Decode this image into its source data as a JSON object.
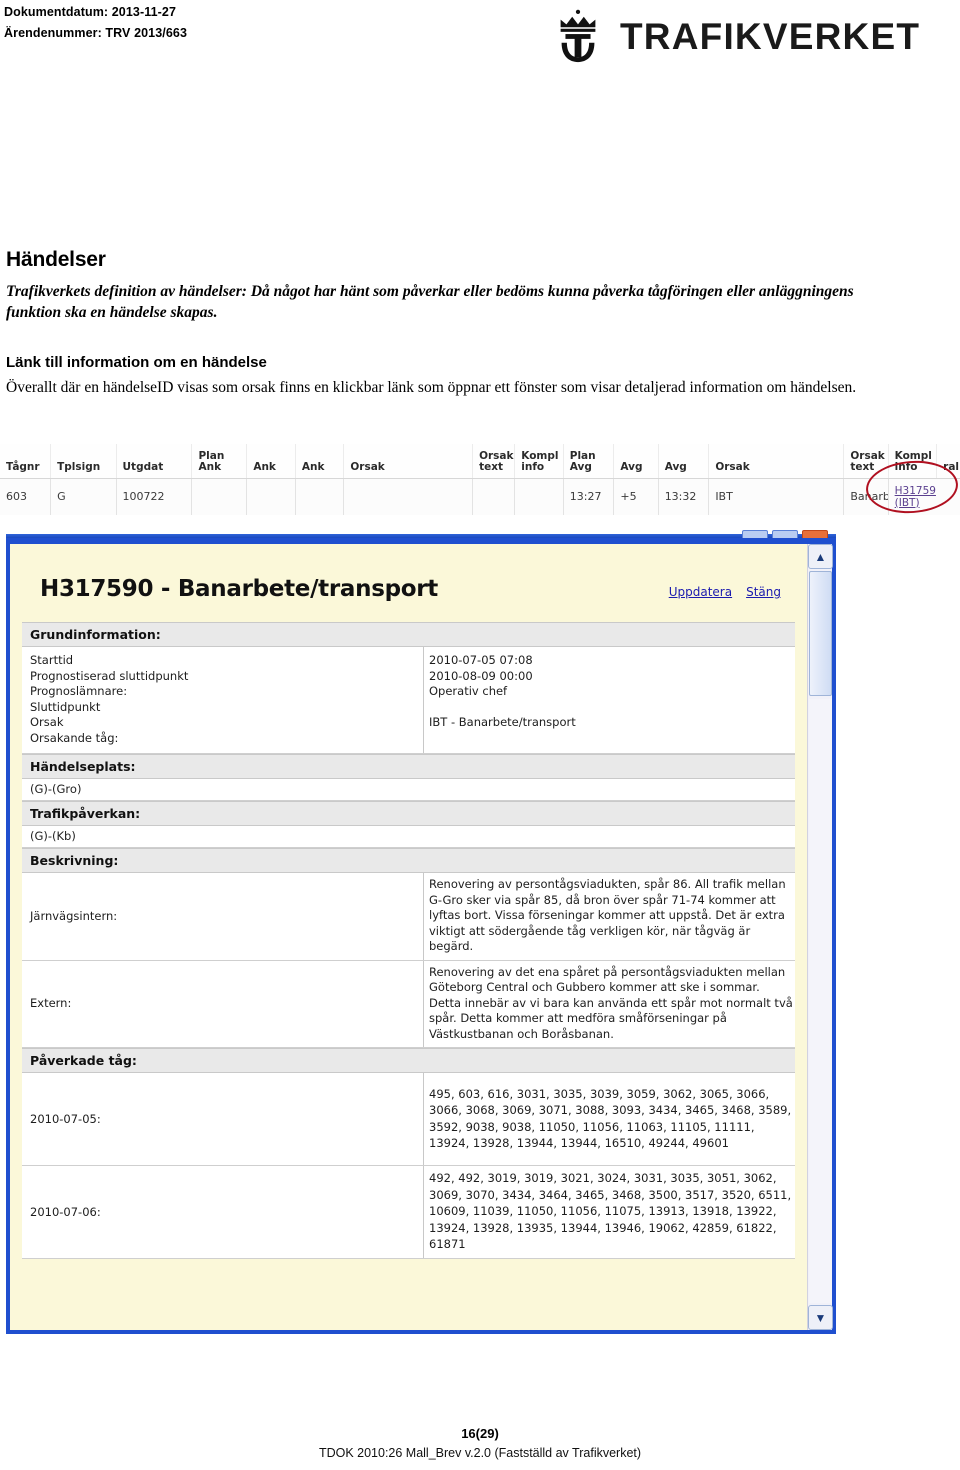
{
  "header": {
    "doc_date": "Dokumentdatum: 2013-11-27",
    "case_number": "Ärendenummer: TRV 2013/663",
    "logo_text": "TRAFIKVERKET",
    "logo_icon": "crown-anchor-icon"
  },
  "content": {
    "page_title": "Händelser",
    "definition": "Trafikverkets definition av händelser: Då något har hänt som påverkar eller bedöms kunna påverka tågföringen eller anläggningens funktion ska en händelse skapas.",
    "sub_title": "Länk till information om en händelse",
    "body": "Överallt där en händelseID visas som orsak finns en klickbar länk som öppnar ett fönster som visar detaljerad information om händelsen."
  },
  "table": {
    "columns": [
      "Tågnr",
      "Tplsign",
      "Utgdat",
      "Plan\nAnk",
      "Ank",
      "Ank",
      "Orsak",
      "Orsak\ntext",
      "Kompl\ninfo",
      "Plan\nAvg",
      "Avg",
      "Avg",
      "Orsak",
      "Orsak\ntext",
      "Kompl\ninfo",
      "ral"
    ],
    "row": {
      "tagnr": "603",
      "tplsign": "G",
      "utgdat": "100722",
      "plan_ank": "",
      "ank1": "",
      "ank2": "",
      "orsak_ank": "",
      "orsak_text_ank": "",
      "kompl_info_ank": "",
      "plan_avg": "13:27",
      "avg1": "+5",
      "avg2": "13:32",
      "orsak_avg": "IBT",
      "orsak_text_avg": "Banarbe",
      "kompl_info_link_1": "H31759",
      "kompl_info_link_2": "(IBT)"
    },
    "annotation_color": "#b01020"
  },
  "popup": {
    "title": "H317590 - Banarbete/transport",
    "actions": {
      "update": "Uppdatera",
      "close": "Stäng"
    },
    "window_border_color": "#1f4fcf",
    "background_color": "#fbf8d9",
    "scroll_up_icon": "chevron-up-icon",
    "scroll_down_icon": "chevron-down-icon",
    "sections": {
      "grundinformation": {
        "heading": "Grundinformation:",
        "rows": [
          {
            "label": "Starttid",
            "value": "2010-07-05 07:08"
          },
          {
            "label": "Prognostiserad sluttidpunkt",
            "value": "2010-08-09 00:00"
          },
          {
            "label": "Prognoslämnare:",
            "value": "Operativ chef"
          },
          {
            "label": "Sluttidpunkt",
            "value": ""
          },
          {
            "label": "Orsak",
            "value": "IBT - Banarbete/transport"
          },
          {
            "label": "Orsakande tåg:",
            "value": ""
          }
        ]
      },
      "handelseplats": {
        "heading": "Händelseplats:",
        "value": "(G)-(Gro)"
      },
      "trafikpaverkan": {
        "heading": "Trafikpåverkan:",
        "value": "(G)-(Kb)"
      },
      "beskrivning": {
        "heading": "Beskrivning:",
        "rows": [
          {
            "label": "Järnvägsintern:",
            "value": "Renovering av persontågsviadukten, spår 86. All trafik mellan G-Gro sker via spår 85, då bron över spår 71-74 kommer att lyftas bort. Vissa förseningar kommer att uppstå. Det är extra viktigt att södergående tåg verkligen kör, när tågväg är begärd."
          },
          {
            "label": "Extern:",
            "value": "Renovering av det ena spåret på persontågsviadukten mellan Göteborg Central och Gubbero kommer att ske i sommar. Detta innebär av vi bara kan använda ett spår mot normalt två spår. Detta kommer att medföra småförseningar på Västkustbanan och Boråsbanan."
          }
        ]
      },
      "paverkade_tag": {
        "heading": "Påverkade tåg:",
        "rows": [
          {
            "label": "2010-07-05:",
            "value": "495, 603, 616, 3031, 3035, 3039, 3059, 3062, 3065, 3066, 3066, 3068, 3069, 3071, 3088, 3093, 3434, 3465, 3468, 3589, 3592, 9038, 9038, 11050, 11056, 11063, 11105, 11111, 13924, 13928, 13944, 13944, 16510, 49244, 49601"
          },
          {
            "label": "2010-07-06:",
            "value": "492, 492, 3019, 3019, 3021, 3024, 3031, 3035, 3051, 3062, 3069, 3070, 3434, 3464, 3465, 3468, 3500, 3517, 3520, 6511, 10609, 11039, 11050, 11056, 11075, 13913, 13918, 13922, 13924, 13928, 13935, 13944, 13946, 19062, 42859, 61822, 61871"
          }
        ]
      }
    }
  },
  "footer": {
    "page": "16(29)",
    "template": "TDOK 2010:26 Mall_Brev v.2.0 (Fastställd av Trafikverket)"
  }
}
